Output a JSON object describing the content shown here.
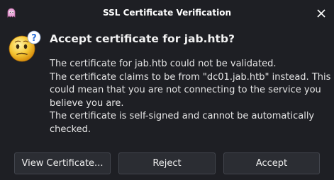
{
  "window": {
    "title": "SSL Certificate Verification",
    "app_icon": "ghost-app-icon",
    "close_icon": "close-icon"
  },
  "dialog": {
    "icon": "thinking-face-icon",
    "heading": "Accept certificate for jab.htb?",
    "message_lines": [
      "The certificate for jab.htb could not be validated.",
      "The certificate claims to be from \"dc01.jab.htb\" instead. This",
      "could mean that you are not connecting to the service you",
      "believe you are.",
      "The certificate is self-signed and cannot be automatically",
      "checked."
    ]
  },
  "buttons": {
    "view_certificate": "View Certificate...",
    "reject": "Reject",
    "accept": "Accept"
  },
  "colors": {
    "background": "#1e1f24",
    "button_bg": "#2b2d33",
    "button_border": "#43464e",
    "text": "#e6e6e6"
  }
}
